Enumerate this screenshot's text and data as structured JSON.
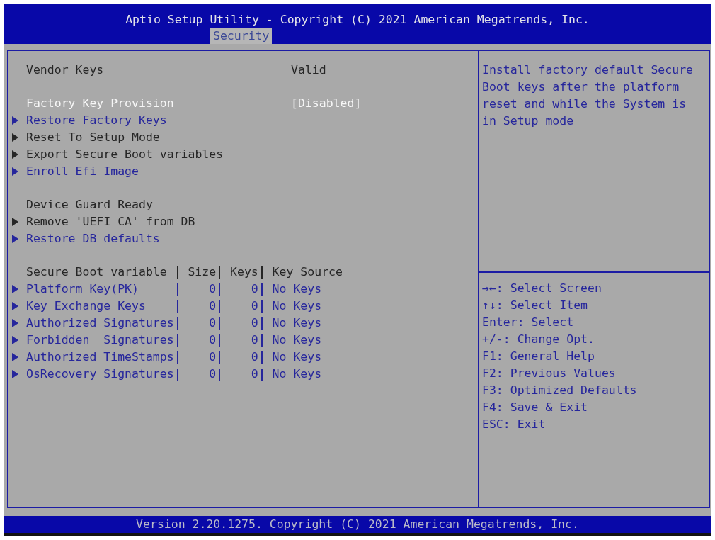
{
  "window": {
    "title": "Aptio Setup Utility - Copyright (C) 2021 American Megatrends, Inc."
  },
  "tabs": [
    {
      "label": "Security",
      "selected": true
    }
  ],
  "menu": {
    "groups": [
      {
        "items": [
          {
            "kind": "info",
            "label": "Vendor Keys",
            "value": "Valid"
          }
        ]
      },
      {
        "items": [
          {
            "kind": "setting",
            "label": "Factory Key Provision",
            "value": "[Disabled]",
            "selected": true,
            "disabled": false
          },
          {
            "kind": "submenu",
            "label": "Restore Factory Keys",
            "selected": false,
            "disabled": false
          },
          {
            "kind": "submenu",
            "label": "Reset To Setup Mode",
            "selected": false,
            "disabled": true
          },
          {
            "kind": "submenu",
            "label": "Export Secure Boot variables",
            "selected": false,
            "disabled": true
          },
          {
            "kind": "submenu",
            "label": "Enroll Efi Image",
            "selected": false,
            "disabled": false
          }
        ]
      },
      {
        "items": [
          {
            "kind": "info",
            "label": "Device Guard Ready"
          },
          {
            "kind": "submenu",
            "label": "Remove 'UEFI CA' from DB",
            "selected": false,
            "disabled": true
          },
          {
            "kind": "submenu",
            "label": "Restore DB defaults",
            "selected": false,
            "disabled": false
          }
        ]
      }
    ]
  },
  "variables_table": {
    "columns": [
      "Secure Boot variable",
      "Size",
      "Keys",
      "Key Source"
    ],
    "rows": [
      {
        "name": "Platform Key(PK)",
        "size": "0",
        "keys": "0",
        "key_source": "No Keys",
        "selected": false,
        "disabled": false
      },
      {
        "name": "Key Exchange Keys",
        "size": "0",
        "keys": "0",
        "key_source": "No Keys",
        "selected": false,
        "disabled": false
      },
      {
        "name": "Authorized Signatures",
        "size": "0",
        "keys": "0",
        "key_source": "No Keys",
        "selected": false,
        "disabled": false
      },
      {
        "name": "Forbidden  Signatures",
        "size": "0",
        "keys": "0",
        "key_source": "No Keys",
        "selected": false,
        "disabled": false
      },
      {
        "name": "Authorized TimeStamps",
        "size": "0",
        "keys": "0",
        "key_source": "No Keys",
        "selected": false,
        "disabled": false
      },
      {
        "name": "OsRecovery Signatures",
        "size": "0",
        "keys": "0",
        "key_source": "No Keys",
        "selected": false,
        "disabled": false
      }
    ]
  },
  "help_text": "Install factory default Secure Boot keys after the platform reset and while the System is in Setup mode",
  "key_hints": [
    "→←: Select Screen",
    "↑↓: Select Item",
    "Enter: Select",
    "+/-: Change Opt.",
    "F1: General Help",
    "F2: Previous Values",
    "F3: Optimized Defaults",
    "F4: Save & Exit",
    "ESC: Exit"
  ],
  "status_bar": {
    "text": "Version 2.20.1275. Copyright (C) 2021 American Megatrends, Inc."
  }
}
